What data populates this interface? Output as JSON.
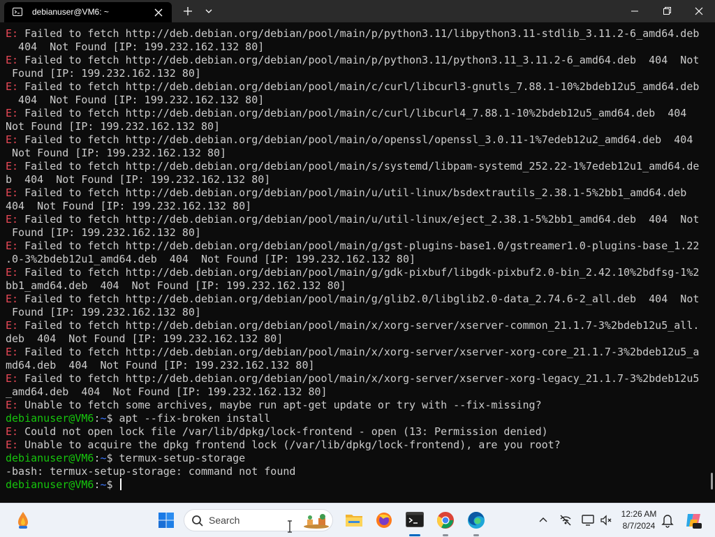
{
  "window": {
    "tab_title": "debianuser@VM6: ~"
  },
  "terminal": {
    "lines": [
      [
        {
          "t": "E: ",
          "c": "err"
        },
        {
          "t": "Failed to fetch http://deb.debian.org/debian/pool/main/p/python3.11/libpython3.11-stdlib_3.11.2-6_amd64.deb"
        }
      ],
      [
        {
          "t": "  404  Not Found [IP: 199.232.162.132 80]"
        }
      ],
      [
        {
          "t": "E: ",
          "c": "err"
        },
        {
          "t": "Failed to fetch http://deb.debian.org/debian/pool/main/p/python3.11/python3.11_3.11.2-6_amd64.deb  404  Not"
        }
      ],
      [
        {
          "t": " Found [IP: 199.232.162.132 80]"
        }
      ],
      [
        {
          "t": "E: ",
          "c": "err"
        },
        {
          "t": "Failed to fetch http://deb.debian.org/debian/pool/main/c/curl/libcurl3-gnutls_7.88.1-10%2bdeb12u5_amd64.deb"
        }
      ],
      [
        {
          "t": "  404  Not Found [IP: 199.232.162.132 80]"
        }
      ],
      [
        {
          "t": "E: ",
          "c": "err"
        },
        {
          "t": "Failed to fetch http://deb.debian.org/debian/pool/main/c/curl/libcurl4_7.88.1-10%2bdeb12u5_amd64.deb  404"
        }
      ],
      [
        {
          "t": "Not Found [IP: 199.232.162.132 80]"
        }
      ],
      [
        {
          "t": "E: ",
          "c": "err"
        },
        {
          "t": "Failed to fetch http://deb.debian.org/debian/pool/main/o/openssl/openssl_3.0.11-1%7edeb12u2_amd64.deb  404"
        }
      ],
      [
        {
          "t": " Not Found [IP: 199.232.162.132 80]"
        }
      ],
      [
        {
          "t": "E: ",
          "c": "err"
        },
        {
          "t": "Failed to fetch http://deb.debian.org/debian/pool/main/s/systemd/libpam-systemd_252.22-1%7edeb12u1_amd64.de"
        }
      ],
      [
        {
          "t": "b  404  Not Found [IP: 199.232.162.132 80]"
        }
      ],
      [
        {
          "t": "E: ",
          "c": "err"
        },
        {
          "t": "Failed to fetch http://deb.debian.org/debian/pool/main/u/util-linux/bsdextrautils_2.38.1-5%2bb1_amd64.deb"
        }
      ],
      [
        {
          "t": "404  Not Found [IP: 199.232.162.132 80]"
        }
      ],
      [
        {
          "t": "E: ",
          "c": "err"
        },
        {
          "t": "Failed to fetch http://deb.debian.org/debian/pool/main/u/util-linux/eject_2.38.1-5%2bb1_amd64.deb  404  Not"
        }
      ],
      [
        {
          "t": " Found [IP: 199.232.162.132 80]"
        }
      ],
      [
        {
          "t": "E: ",
          "c": "err"
        },
        {
          "t": "Failed to fetch http://deb.debian.org/debian/pool/main/g/gst-plugins-base1.0/gstreamer1.0-plugins-base_1.22"
        }
      ],
      [
        {
          "t": ".0-3%2bdeb12u1_amd64.deb  404  Not Found [IP: 199.232.162.132 80]"
        }
      ],
      [
        {
          "t": "E: ",
          "c": "err"
        },
        {
          "t": "Failed to fetch http://deb.debian.org/debian/pool/main/g/gdk-pixbuf/libgdk-pixbuf2.0-bin_2.42.10%2bdfsg-1%2"
        }
      ],
      [
        {
          "t": "bb1_amd64.deb  404  Not Found [IP: 199.232.162.132 80]"
        }
      ],
      [
        {
          "t": "E: ",
          "c": "err"
        },
        {
          "t": "Failed to fetch http://deb.debian.org/debian/pool/main/g/glib2.0/libglib2.0-data_2.74.6-2_all.deb  404  Not"
        }
      ],
      [
        {
          "t": " Found [IP: 199.232.162.132 80]"
        }
      ],
      [
        {
          "t": "E: ",
          "c": "err"
        },
        {
          "t": "Failed to fetch http://deb.debian.org/debian/pool/main/x/xorg-server/xserver-common_21.1.7-3%2bdeb12u5_all."
        }
      ],
      [
        {
          "t": "deb  404  Not Found [IP: 199.232.162.132 80]"
        }
      ],
      [
        {
          "t": "E: ",
          "c": "err"
        },
        {
          "t": "Failed to fetch http://deb.debian.org/debian/pool/main/x/xorg-server/xserver-xorg-core_21.1.7-3%2bdeb12u5_a"
        }
      ],
      [
        {
          "t": "md64.deb  404  Not Found [IP: 199.232.162.132 80]"
        }
      ],
      [
        {
          "t": "E: ",
          "c": "err"
        },
        {
          "t": "Failed to fetch http://deb.debian.org/debian/pool/main/x/xorg-server/xserver-xorg-legacy_21.1.7-3%2bdeb12u5"
        }
      ],
      [
        {
          "t": "_amd64.deb  404  Not Found [IP: 199.232.162.132 80]"
        }
      ],
      [
        {
          "t": "E: ",
          "c": "err"
        },
        {
          "t": "Unable to fetch some archives, maybe run apt-get update or try with --fix-missing?"
        }
      ],
      [
        {
          "t": "debianuser@VM6",
          "c": "pu"
        },
        {
          "t": ":"
        },
        {
          "t": "~",
          "c": "pp"
        },
        {
          "t": "$ apt --fix-broken install"
        }
      ],
      [
        {
          "t": "E: ",
          "c": "err"
        },
        {
          "t": "Could not open lock file /var/lib/dpkg/lock-frontend - open (13: Permission denied)"
        }
      ],
      [
        {
          "t": "E: ",
          "c": "err"
        },
        {
          "t": "Unable to acquire the dpkg frontend lock (/var/lib/dpkg/lock-frontend), are you root?"
        }
      ],
      [
        {
          "t": "debianuser@VM6",
          "c": "pu"
        },
        {
          "t": ":"
        },
        {
          "t": "~",
          "c": "pp"
        },
        {
          "t": "$ termux-setup-storage"
        }
      ],
      [
        {
          "t": "-bash: termux-setup-storage: command not found"
        }
      ],
      [
        {
          "t": "debianuser@VM6",
          "c": "pu"
        },
        {
          "t": ":"
        },
        {
          "t": "~",
          "c": "pp"
        },
        {
          "t": "$ "
        }
      ]
    ]
  },
  "taskbar": {
    "search_label": "Search",
    "time": "12:26 AM",
    "date": "8/7/2024",
    "icons": [
      "widgets-icon",
      "windows-start-icon",
      "search-icon",
      "file-explorer-icon",
      "firefox-icon",
      "terminal-icon",
      "chrome-icon",
      "edge-icon",
      "chevron-up-icon",
      "network-icon",
      "display-icon",
      "volume-icon",
      "notification-bell-icon",
      "copilot-icon"
    ]
  },
  "colors": {
    "terminal_bg": "#0c0c0c",
    "text": "#cccccc",
    "error": "#e74856",
    "prompt_user": "#16c60c",
    "prompt_path": "#3b78ff",
    "taskbar_bg": "#eef2f8"
  }
}
